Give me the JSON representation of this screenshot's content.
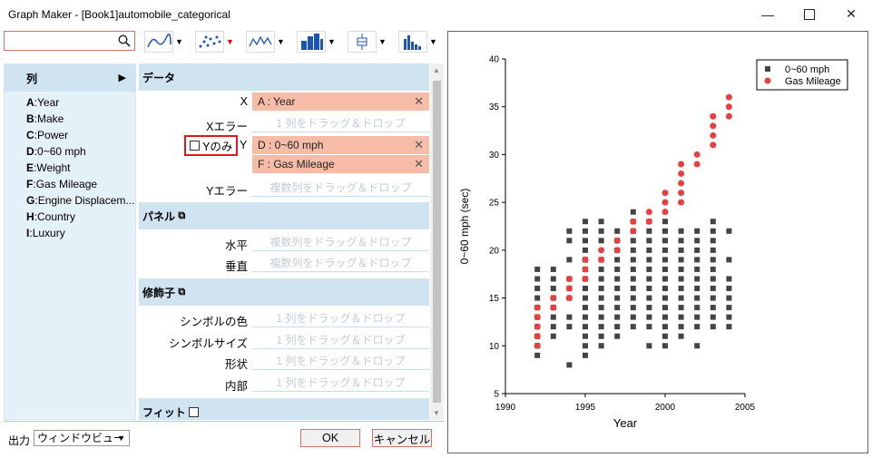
{
  "window": {
    "title": "Graph Maker - [Book1]automobile_categorical"
  },
  "search": {
    "placeholder": ""
  },
  "columns_panel": {
    "header": "列",
    "items": [
      {
        "key": "A",
        "label": "Year"
      },
      {
        "key": "B",
        "label": "Make"
      },
      {
        "key": "C",
        "label": "Power"
      },
      {
        "key": "D",
        "label": "0~60 mph"
      },
      {
        "key": "E",
        "label": "Weight"
      },
      {
        "key": "F",
        "label": "Gas Mileage"
      },
      {
        "key": "G",
        "label": "Engine Displacem..."
      },
      {
        "key": "H",
        "label": "Country"
      },
      {
        "key": "I",
        "label": "Luxury"
      }
    ]
  },
  "data_section": {
    "header": "データ",
    "x_label": "X",
    "x_value": "A : Year",
    "xerr_label": "Xエラー",
    "xerr_placeholder": "1 列をドラッグ＆ドロップ",
    "yonly_label": "Yのみ",
    "y_label": "Y",
    "y_values": [
      "D : 0~60 mph",
      "F : Gas Mileage"
    ],
    "yerr_label": "Yエラー",
    "yerr_placeholder": "複数列をドラッグ＆ドロップ"
  },
  "panel_section": {
    "header": "パネル",
    "horizontal_label": "水平",
    "horizontal_placeholder": "複数列をドラッグ＆ドロップ",
    "vertical_label": "垂直",
    "vertical_placeholder": "複数列をドラッグ＆ドロップ"
  },
  "modifier_section": {
    "header": "修飾子",
    "rows": [
      {
        "label": "シンボルの色",
        "placeholder": "1 列をドラッグ＆ドロップ"
      },
      {
        "label": "シンボルサイズ",
        "placeholder": "1 列をドラッグ＆ドロップ"
      },
      {
        "label": "形状",
        "placeholder": "1 列をドラッグ＆ドロップ"
      },
      {
        "label": "内部",
        "placeholder": "1 列をドラッグ＆ドロップ"
      }
    ]
  },
  "fit_section": {
    "header": "フィット"
  },
  "bottom": {
    "output_label": "出力",
    "output_value": "ウィンドウビュー",
    "ok": "OK",
    "cancel": "キャンセル"
  },
  "chart_data": {
    "type": "scatter",
    "xlabel": "Year",
    "ylabel": "0~60 mph (sec)",
    "xlim": [
      1990,
      2005
    ],
    "ylim": [
      5,
      40
    ],
    "xticks": [
      1990,
      1995,
      2000,
      2005
    ],
    "yticks": [
      5,
      10,
      15,
      20,
      25,
      30,
      35,
      40
    ],
    "legend_position": "top-right",
    "series": [
      {
        "name": "0~60 mph",
        "marker": "square",
        "color": "#444444",
        "points": [
          [
            1992,
            9
          ],
          [
            1992,
            10
          ],
          [
            1992,
            11
          ],
          [
            1992,
            12
          ],
          [
            1992,
            13
          ],
          [
            1992,
            14
          ],
          [
            1992,
            15
          ],
          [
            1992,
            16
          ],
          [
            1992,
            17
          ],
          [
            1992,
            18
          ],
          [
            1993,
            11
          ],
          [
            1993,
            12
          ],
          [
            1993,
            13
          ],
          [
            1993,
            14
          ],
          [
            1993,
            15
          ],
          [
            1993,
            16
          ],
          [
            1993,
            17
          ],
          [
            1993,
            18
          ],
          [
            1994,
            8
          ],
          [
            1994,
            12
          ],
          [
            1994,
            13
          ],
          [
            1994,
            15
          ],
          [
            1994,
            16
          ],
          [
            1994,
            17
          ],
          [
            1994,
            19
          ],
          [
            1994,
            21
          ],
          [
            1994,
            22
          ],
          [
            1995,
            9
          ],
          [
            1995,
            10
          ],
          [
            1995,
            11
          ],
          [
            1995,
            12
          ],
          [
            1995,
            13
          ],
          [
            1995,
            14
          ],
          [
            1995,
            15
          ],
          [
            1995,
            16
          ],
          [
            1995,
            17
          ],
          [
            1995,
            18
          ],
          [
            1995,
            19
          ],
          [
            1995,
            20
          ],
          [
            1995,
            21
          ],
          [
            1995,
            22
          ],
          [
            1995,
            23
          ],
          [
            1996,
            10
          ],
          [
            1996,
            11
          ],
          [
            1996,
            12
          ],
          [
            1996,
            13
          ],
          [
            1996,
            14
          ],
          [
            1996,
            15
          ],
          [
            1996,
            16
          ],
          [
            1996,
            17
          ],
          [
            1996,
            18
          ],
          [
            1996,
            19
          ],
          [
            1996,
            21
          ],
          [
            1996,
            22
          ],
          [
            1996,
            23
          ],
          [
            1997,
            11
          ],
          [
            1997,
            12
          ],
          [
            1997,
            13
          ],
          [
            1997,
            14
          ],
          [
            1997,
            15
          ],
          [
            1997,
            16
          ],
          [
            1997,
            17
          ],
          [
            1997,
            18
          ],
          [
            1997,
            19
          ],
          [
            1997,
            20
          ],
          [
            1997,
            21
          ],
          [
            1997,
            22
          ],
          [
            1998,
            12
          ],
          [
            1998,
            13
          ],
          [
            1998,
            14
          ],
          [
            1998,
            15
          ],
          [
            1998,
            16
          ],
          [
            1998,
            17
          ],
          [
            1998,
            18
          ],
          [
            1998,
            19
          ],
          [
            1998,
            20
          ],
          [
            1998,
            21
          ],
          [
            1998,
            22
          ],
          [
            1998,
            23
          ],
          [
            1998,
            24
          ],
          [
            1999,
            10
          ],
          [
            1999,
            12
          ],
          [
            1999,
            13
          ],
          [
            1999,
            14
          ],
          [
            1999,
            15
          ],
          [
            1999,
            16
          ],
          [
            1999,
            17
          ],
          [
            1999,
            18
          ],
          [
            1999,
            19
          ],
          [
            1999,
            20
          ],
          [
            1999,
            21
          ],
          [
            1999,
            22
          ],
          [
            1999,
            23
          ],
          [
            2000,
            10
          ],
          [
            2000,
            11
          ],
          [
            2000,
            12
          ],
          [
            2000,
            13
          ],
          [
            2000,
            14
          ],
          [
            2000,
            15
          ],
          [
            2000,
            16
          ],
          [
            2000,
            17
          ],
          [
            2000,
            18
          ],
          [
            2000,
            19
          ],
          [
            2000,
            20
          ],
          [
            2000,
            21
          ],
          [
            2000,
            22
          ],
          [
            2000,
            23
          ],
          [
            2001,
            11
          ],
          [
            2001,
            12
          ],
          [
            2001,
            13
          ],
          [
            2001,
            14
          ],
          [
            2001,
            15
          ],
          [
            2001,
            16
          ],
          [
            2001,
            17
          ],
          [
            2001,
            18
          ],
          [
            2001,
            19
          ],
          [
            2001,
            20
          ],
          [
            2001,
            21
          ],
          [
            2001,
            22
          ],
          [
            2002,
            10
          ],
          [
            2002,
            12
          ],
          [
            2002,
            13
          ],
          [
            2002,
            14
          ],
          [
            2002,
            15
          ],
          [
            2002,
            16
          ],
          [
            2002,
            17
          ],
          [
            2002,
            18
          ],
          [
            2002,
            19
          ],
          [
            2002,
            20
          ],
          [
            2002,
            21
          ],
          [
            2002,
            22
          ],
          [
            2003,
            12
          ],
          [
            2003,
            13
          ],
          [
            2003,
            14
          ],
          [
            2003,
            15
          ],
          [
            2003,
            16
          ],
          [
            2003,
            17
          ],
          [
            2003,
            18
          ],
          [
            2003,
            19
          ],
          [
            2003,
            20
          ],
          [
            2003,
            21
          ],
          [
            2003,
            22
          ],
          [
            2003,
            23
          ],
          [
            2004,
            12
          ],
          [
            2004,
            13
          ],
          [
            2004,
            14
          ],
          [
            2004,
            15
          ],
          [
            2004,
            16
          ],
          [
            2004,
            17
          ],
          [
            2004,
            19
          ],
          [
            2004,
            22
          ]
        ]
      },
      {
        "name": "Gas Mileage",
        "marker": "circle",
        "color": "#e84040",
        "points": [
          [
            1992,
            10
          ],
          [
            1992,
            11
          ],
          [
            1992,
            12
          ],
          [
            1992,
            13
          ],
          [
            1992,
            14
          ],
          [
            1993,
            14
          ],
          [
            1993,
            15
          ],
          [
            1994,
            15
          ],
          [
            1994,
            16
          ],
          [
            1994,
            17
          ],
          [
            1995,
            17
          ],
          [
            1995,
            18
          ],
          [
            1995,
            19
          ],
          [
            1996,
            19
          ],
          [
            1996,
            20
          ],
          [
            1997,
            20
          ],
          [
            1997,
            21
          ],
          [
            1998,
            22
          ],
          [
            1998,
            23
          ],
          [
            1999,
            23
          ],
          [
            1999,
            24
          ],
          [
            2000,
            24
          ],
          [
            2000,
            25
          ],
          [
            2000,
            26
          ],
          [
            2001,
            25
          ],
          [
            2001,
            26
          ],
          [
            2001,
            27
          ],
          [
            2001,
            28
          ],
          [
            2001,
            29
          ],
          [
            2002,
            29
          ],
          [
            2002,
            30
          ],
          [
            2003,
            31
          ],
          [
            2003,
            32
          ],
          [
            2003,
            33
          ],
          [
            2003,
            34
          ],
          [
            2004,
            34
          ],
          [
            2004,
            35
          ],
          [
            2004,
            36
          ]
        ]
      }
    ]
  }
}
